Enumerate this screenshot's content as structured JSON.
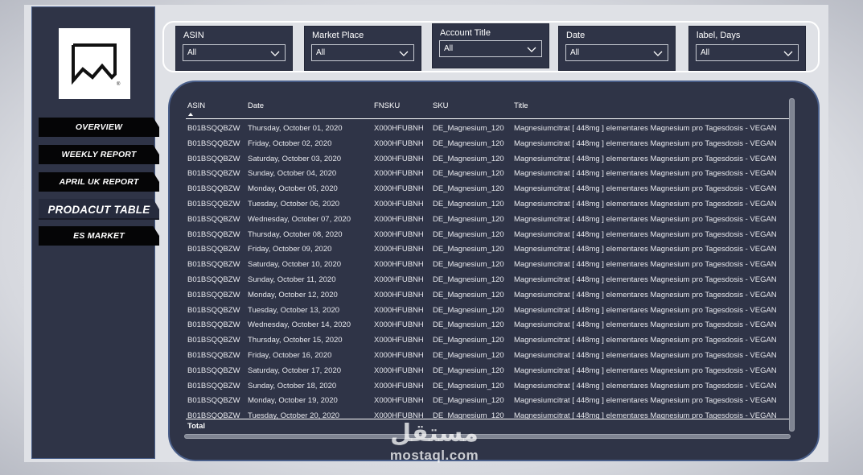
{
  "sidebar": {
    "logo_icon": "mountain-frame-logo-icon",
    "logo_mark": "®",
    "nav": [
      {
        "label": "OVERVIEW",
        "active": false
      },
      {
        "label": "WEEKLY REPORT",
        "active": false
      },
      {
        "label": "APRIL UK REPORT",
        "active": false
      },
      {
        "label": "PRODACUT TABLE",
        "active": true
      },
      {
        "label": "ES MARKET",
        "active": false
      }
    ]
  },
  "filters": [
    {
      "label": "ASIN",
      "value": "All"
    },
    {
      "label": "Market Place",
      "value": "All"
    },
    {
      "label": "Account Title",
      "value": "All"
    },
    {
      "label": "Date",
      "value": "All"
    },
    {
      "label": "label, Days",
      "value": "All"
    }
  ],
  "table": {
    "columns": [
      "ASIN",
      "Date",
      "FNSKU",
      "SKU",
      "Title"
    ],
    "sorted_column": "ASIN",
    "rows": [
      [
        "B01BSQQBZW",
        "Thursday, October 01, 2020",
        "X000HFUBNH",
        "DE_Magnesium_120",
        "Magnesiumcitrat [ 448mg ] elementares Magnesium pro Tagesdosis - VEGAN"
      ],
      [
        "B01BSQQBZW",
        "Friday, October 02, 2020",
        "X000HFUBNH",
        "DE_Magnesium_120",
        "Magnesiumcitrat [ 448mg ] elementares Magnesium pro Tagesdosis - VEGAN"
      ],
      [
        "B01BSQQBZW",
        "Saturday, October 03, 2020",
        "X000HFUBNH",
        "DE_Magnesium_120",
        "Magnesiumcitrat [ 448mg ] elementares Magnesium pro Tagesdosis - VEGAN"
      ],
      [
        "B01BSQQBZW",
        "Sunday, October 04, 2020",
        "X000HFUBNH",
        "DE_Magnesium_120",
        "Magnesiumcitrat [ 448mg ] elementares Magnesium pro Tagesdosis - VEGAN"
      ],
      [
        "B01BSQQBZW",
        "Monday, October 05, 2020",
        "X000HFUBNH",
        "DE_Magnesium_120",
        "Magnesiumcitrat [ 448mg ] elementares Magnesium pro Tagesdosis - VEGAN"
      ],
      [
        "B01BSQQBZW",
        "Tuesday, October 06, 2020",
        "X000HFUBNH",
        "DE_Magnesium_120",
        "Magnesiumcitrat [ 448mg ] elementares Magnesium pro Tagesdosis - VEGAN"
      ],
      [
        "B01BSQQBZW",
        "Wednesday, October 07, 2020",
        "X000HFUBNH",
        "DE_Magnesium_120",
        "Magnesiumcitrat [ 448mg ] elementares Magnesium pro Tagesdosis - VEGAN"
      ],
      [
        "B01BSQQBZW",
        "Thursday, October 08, 2020",
        "X000HFUBNH",
        "DE_Magnesium_120",
        "Magnesiumcitrat [ 448mg ] elementares Magnesium pro Tagesdosis - VEGAN"
      ],
      [
        "B01BSQQBZW",
        "Friday, October 09, 2020",
        "X000HFUBNH",
        "DE_Magnesium_120",
        "Magnesiumcitrat [ 448mg ] elementares Magnesium pro Tagesdosis - VEGAN"
      ],
      [
        "B01BSQQBZW",
        "Saturday, October 10, 2020",
        "X000HFUBNH",
        "DE_Magnesium_120",
        "Magnesiumcitrat [ 448mg ] elementares Magnesium pro Tagesdosis - VEGAN"
      ],
      [
        "B01BSQQBZW",
        "Sunday, October 11, 2020",
        "X000HFUBNH",
        "DE_Magnesium_120",
        "Magnesiumcitrat [ 448mg ] elementares Magnesium pro Tagesdosis - VEGAN"
      ],
      [
        "B01BSQQBZW",
        "Monday, October 12, 2020",
        "X000HFUBNH",
        "DE_Magnesium_120",
        "Magnesiumcitrat [ 448mg ] elementares Magnesium pro Tagesdosis - VEGAN"
      ],
      [
        "B01BSQQBZW",
        "Tuesday, October 13, 2020",
        "X000HFUBNH",
        "DE_Magnesium_120",
        "Magnesiumcitrat [ 448mg ] elementares Magnesium pro Tagesdosis - VEGAN"
      ],
      [
        "B01BSQQBZW",
        "Wednesday, October 14, 2020",
        "X000HFUBNH",
        "DE_Magnesium_120",
        "Magnesiumcitrat [ 448mg ] elementares Magnesium pro Tagesdosis - VEGAN"
      ],
      [
        "B01BSQQBZW",
        "Thursday, October 15, 2020",
        "X000HFUBNH",
        "DE_Magnesium_120",
        "Magnesiumcitrat [ 448mg ] elementares Magnesium pro Tagesdosis - VEGAN"
      ],
      [
        "B01BSQQBZW",
        "Friday, October 16, 2020",
        "X000HFUBNH",
        "DE_Magnesium_120",
        "Magnesiumcitrat [ 448mg ] elementares Magnesium pro Tagesdosis - VEGAN"
      ],
      [
        "B01BSQQBZW",
        "Saturday, October 17, 2020",
        "X000HFUBNH",
        "DE_Magnesium_120",
        "Magnesiumcitrat [ 448mg ] elementares Magnesium pro Tagesdosis - VEGAN"
      ],
      [
        "B01BSQQBZW",
        "Sunday, October 18, 2020",
        "X000HFUBNH",
        "DE_Magnesium_120",
        "Magnesiumcitrat [ 448mg ] elementares Magnesium pro Tagesdosis - VEGAN"
      ],
      [
        "B01BSQQBZW",
        "Monday, October 19, 2020",
        "X000HFUBNH",
        "DE_Magnesium_120",
        "Magnesiumcitrat [ 448mg ] elementares Magnesium pro Tagesdosis - VEGAN"
      ],
      [
        "B01BSQQBZW",
        "Tuesday, October 20, 2020",
        "X000HFUBNH",
        "DE_Magnesium_120",
        "Magnesiumcitrat [ 448mg ] elementares Magnesium pro Tagesdosis - VEGAN"
      ]
    ],
    "total_label": "Total"
  },
  "watermark": {
    "arabic": "مستقل",
    "latin": "mostaql.com"
  }
}
